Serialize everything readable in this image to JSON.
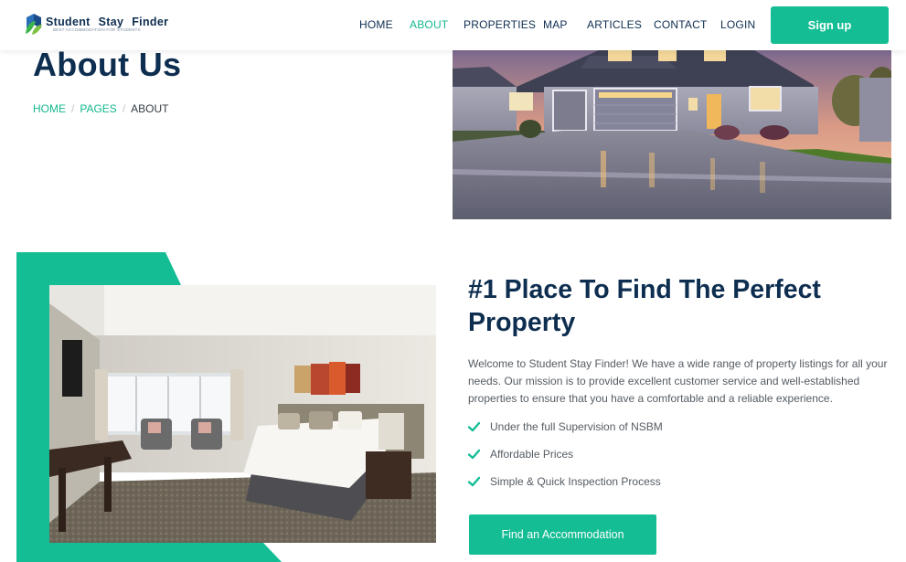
{
  "brand": {
    "word1": "Student",
    "word2": "Stay",
    "word3": "Finder",
    "tagline": "BEST ACCOMMODATION FOR STUDENTS"
  },
  "nav": {
    "items": [
      {
        "label": "HOME",
        "active": false
      },
      {
        "label": "ABOUT",
        "active": true
      },
      {
        "label": "PROPERTIES",
        "active": false
      },
      {
        "label": "MAP",
        "active": false
      },
      {
        "label": "ARTICLES",
        "active": false
      },
      {
        "label": "CONTACT",
        "active": false
      },
      {
        "label": "LOGIN",
        "active": false
      }
    ],
    "signup_label": "Sign up"
  },
  "header": {
    "title": "About Us",
    "breadcrumb": [
      {
        "label": "HOME"
      },
      {
        "label": "PAGES"
      },
      {
        "label": "ABOUT"
      }
    ],
    "separator": "/"
  },
  "about": {
    "heading": "#1 Place To Find The Perfect Property",
    "paragraph": "Welcome to Student Stay Finder! We have a wide range of property listings for all your needs. Our mission is to provide excellent customer service and well-established properties to ensure that you have a comfortable and a reliable experience.",
    "features": [
      "Under the full Supervision of NSBM",
      "Affordable Prices",
      "Simple & Quick Inspection Process"
    ],
    "cta_label": "Find an Accommodation"
  },
  "colors": {
    "primary": "#14bd94",
    "dark": "#0e2e50",
    "text": "#555c63"
  },
  "icons": [
    "logo-mark-icon",
    "check-icon"
  ]
}
